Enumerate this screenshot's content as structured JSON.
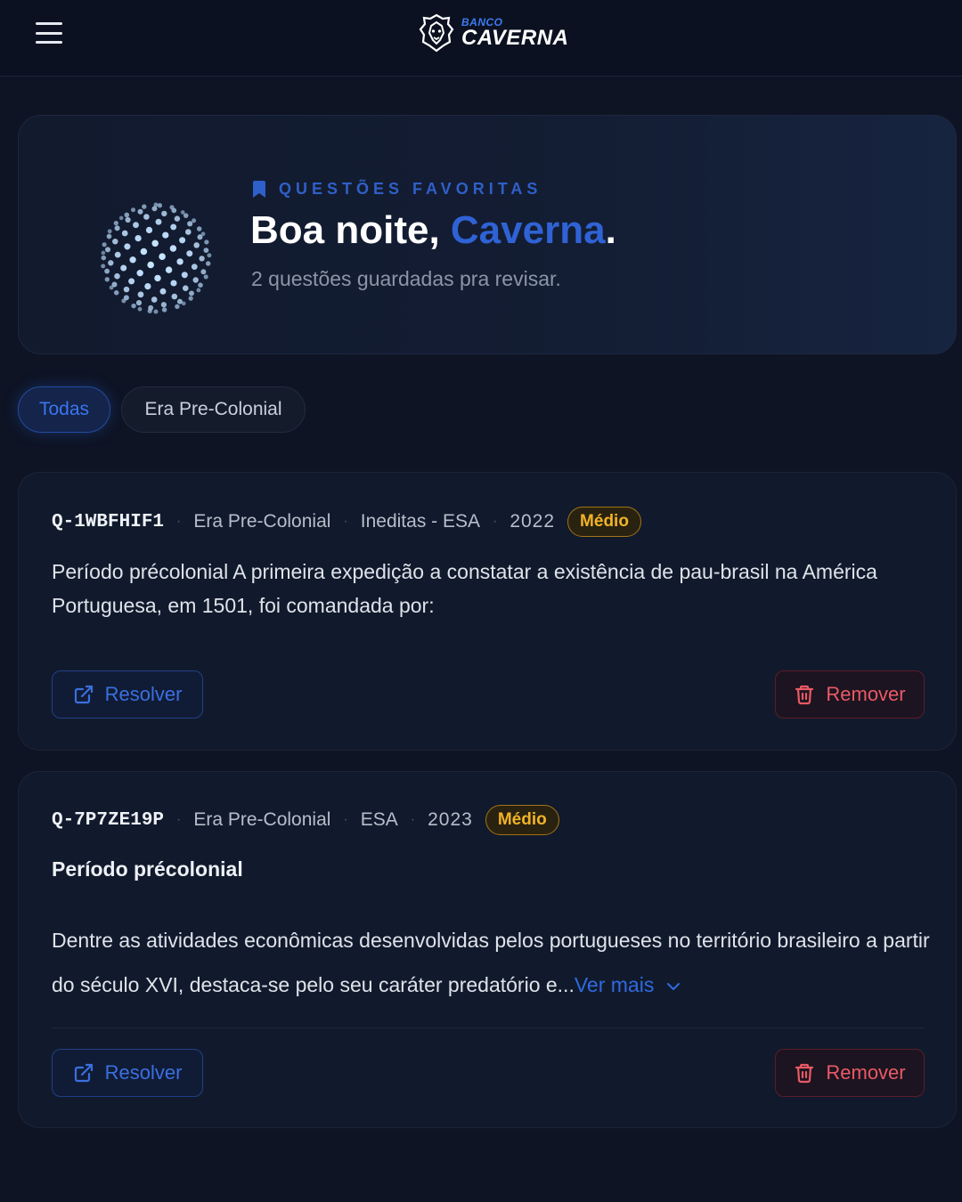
{
  "header": {
    "menu_icon": "hamburger-menu-icon",
    "logo_icon": "lion-head-icon",
    "logo_small": "BANCO",
    "logo_big": "CAVERNA"
  },
  "hero": {
    "kicker_icon": "bookmark-icon",
    "kicker": "QUESTÕES FAVORITAS",
    "greeting": "Boa noite, ",
    "name": "Caverna",
    "period": ".",
    "subtitle": "2 questões guardadas pra revisar.",
    "illustration": "dotted-sphere-illustration"
  },
  "filters": {
    "all": "Todas",
    "topic": "Era Pre-Colonial"
  },
  "questions": [
    {
      "id": "Q-1WBFHIF1",
      "topic": "Era Pre-Colonial",
      "source": "Ineditas - ESA",
      "year": "2022",
      "difficulty": "Médio",
      "text": "Período précolonial A primeira expedição a constatar a existência de pau-brasil na América Portuguesa, em 1501, foi comandada por:",
      "resolve": "Resolver",
      "remove": "Remover"
    },
    {
      "id": "Q-7P7ZE19P",
      "topic": "Era Pre-Colonial",
      "source": "ESA",
      "year": "2023",
      "difficulty": "Médio",
      "title": "Período précolonial",
      "text": "Dentre as atividades econômicas desenvolvidas pelos portugueses no território brasileiro a partir do século XVI, destaca-se pelo seu caráter predatório e...",
      "more": "Ver mais",
      "resolve": "Resolver",
      "remove": "Remover"
    }
  ],
  "colors": {
    "accent": "#2f62d4",
    "danger": "#e95a66",
    "warning": "#f1b328",
    "background": "#0e1424"
  }
}
